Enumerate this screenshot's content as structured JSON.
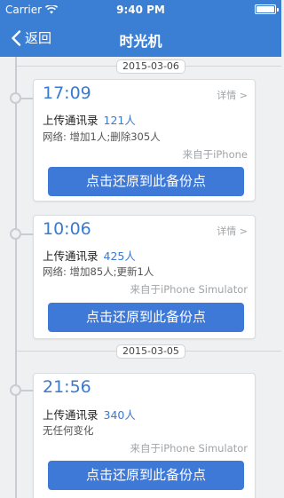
{
  "status_bar": {
    "carrier": "Carrier",
    "time": "9:40 PM",
    "battery_level": 1.0,
    "wifi_icon": "wifi-icon",
    "battery_icon": "battery-icon"
  },
  "nav": {
    "back_label": "返回",
    "back_icon": "chevron-left-icon",
    "title": "时光机"
  },
  "colors": {
    "primary": "#3b7fd4",
    "button": "#3f79d8",
    "accent_text": "#3a7ad0",
    "background": "#eef0f2"
  },
  "timeline": [
    {
      "date": "2015-03-06",
      "entries": [
        {
          "time": "17:09",
          "detail_label": "详情 >",
          "action_label": "上传通讯录",
          "count": "121人",
          "change": "网络: 增加1人;删除305人",
          "source": "来自于iPhone",
          "restore_label": "点击还原到此备份点"
        },
        {
          "time": "10:06",
          "detail_label": "详情 >",
          "action_label": "上传通讯录",
          "count": "425人",
          "change": "网络: 增加85人;更新1人",
          "source": "来自于iPhone Simulator",
          "restore_label": "点击还原到此备份点"
        }
      ]
    },
    {
      "date": "2015-03-05",
      "entries": [
        {
          "time": "21:56",
          "action_label": "上传通讯录",
          "count": "340人",
          "change": "无任何变化",
          "source": "来自于iPhone Simulator",
          "restore_label": "点击还原到此备份点"
        }
      ]
    }
  ]
}
